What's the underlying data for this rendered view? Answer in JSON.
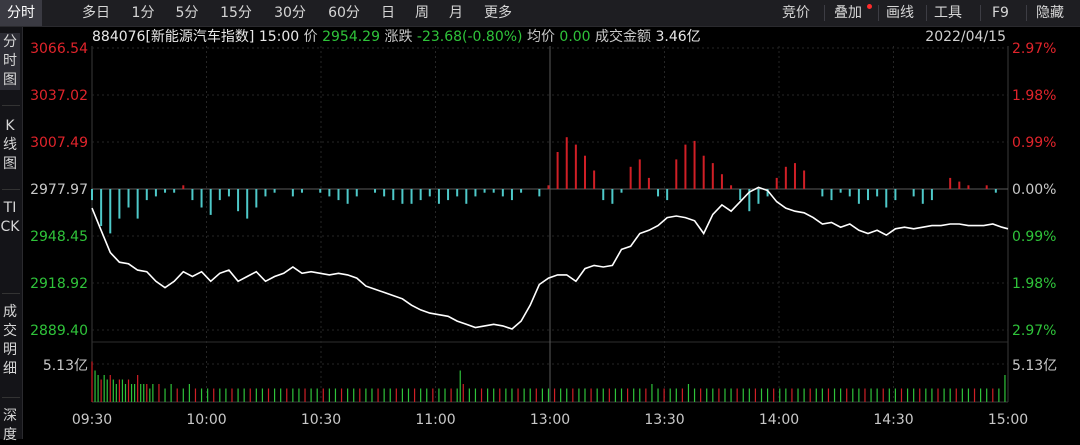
{
  "toolbar": {
    "tabs": [
      {
        "label": "分时",
        "active": true
      },
      {
        "label": "多日"
      },
      {
        "label": "1分"
      },
      {
        "label": "5分"
      },
      {
        "label": "15分"
      },
      {
        "label": "30分"
      },
      {
        "label": "60分"
      },
      {
        "label": "日"
      },
      {
        "label": "周"
      },
      {
        "label": "月"
      },
      {
        "label": "更多"
      }
    ],
    "tools": [
      {
        "label": "竞价"
      },
      {
        "label": "叠加"
      },
      {
        "label": "画线"
      },
      {
        "label": "工具"
      },
      {
        "label": "F9"
      },
      {
        "label": "隐藏"
      }
    ]
  },
  "sidebar": {
    "items": [
      {
        "label": "分时图",
        "active": true
      },
      {
        "label": "K线图"
      },
      {
        "label": "TICK"
      },
      {
        "label": "成交明细"
      },
      {
        "label": "深度"
      }
    ]
  },
  "info": {
    "code_name": "884076[新能源汽车指数]",
    "time": "15:00",
    "price_label": "价",
    "price": "2954.29",
    "change_label": "涨跌",
    "change": "-23.68(-0.80%)",
    "avg_label": "均价",
    "avg": "0.00",
    "amount_label": "成交金额",
    "amount": "3.46亿",
    "date": "2022/04/15"
  },
  "colors": {
    "up": "#e0242b",
    "down": "#2fc33a",
    "bar_up": "#d01f26",
    "bar_down": "#4ec9c9",
    "line": "#ffffff"
  },
  "chart_data": {
    "type": "line",
    "base_price": 2977.97,
    "ylim": [
      2889.4,
      3066.54
    ],
    "price_ticks": [
      "3066.54",
      "3037.02",
      "3007.49",
      "2977.97",
      "2948.45",
      "2918.92",
      "2889.40"
    ],
    "pct_ticks": [
      "2.97%",
      "1.98%",
      "0.99%",
      "0.00%",
      "0.99%",
      "1.98%",
      "2.97%"
    ],
    "volume_max_label": "5.13亿",
    "xlabels": [
      "09:30",
      "10:00",
      "10:30",
      "11:00",
      "13:00",
      "13:30",
      "14:00",
      "14:30",
      "15:00"
    ],
    "price_series": [
      [
        0,
        2966
      ],
      [
        3,
        2952
      ],
      [
        6,
        2938
      ],
      [
        9,
        2932
      ],
      [
        12,
        2931
      ],
      [
        15,
        2927
      ],
      [
        18,
        2926
      ],
      [
        21,
        2920
      ],
      [
        24,
        2916
      ],
      [
        27,
        2920
      ],
      [
        30,
        2926
      ],
      [
        33,
        2923
      ],
      [
        36,
        2926
      ],
      [
        39,
        2920
      ],
      [
        42,
        2925
      ],
      [
        45,
        2927
      ],
      [
        48,
        2920
      ],
      [
        51,
        2923
      ],
      [
        54,
        2926
      ],
      [
        57,
        2920
      ],
      [
        60,
        2923
      ],
      [
        63,
        2925
      ],
      [
        66,
        2929
      ],
      [
        69,
        2925
      ],
      [
        72,
        2926
      ],
      [
        75,
        2925
      ],
      [
        78,
        2924
      ],
      [
        81,
        2925
      ],
      [
        84,
        2924
      ],
      [
        87,
        2922
      ],
      [
        90,
        2917
      ],
      [
        93,
        2915
      ],
      [
        96,
        2913
      ],
      [
        99,
        2911
      ],
      [
        102,
        2909
      ],
      [
        105,
        2905
      ],
      [
        108,
        2902
      ],
      [
        111,
        2900
      ],
      [
        114,
        2899
      ],
      [
        117,
        2898
      ],
      [
        120,
        2895
      ],
      [
        123,
        2893
      ],
      [
        126,
        2891
      ],
      [
        129,
        2892
      ],
      [
        132,
        2893
      ],
      [
        135,
        2892
      ],
      [
        138,
        2890
      ],
      [
        141,
        2895
      ],
      [
        144,
        2905
      ],
      [
        147,
        2918
      ],
      [
        150,
        2922
      ],
      [
        153,
        2924
      ],
      [
        156,
        2924
      ],
      [
        159,
        2920
      ],
      [
        162,
        2928
      ],
      [
        165,
        2930
      ],
      [
        168,
        2929
      ],
      [
        171,
        2930
      ],
      [
        174,
        2940
      ],
      [
        177,
        2942
      ],
      [
        180,
        2950
      ],
      [
        183,
        2952
      ],
      [
        186,
        2955
      ],
      [
        189,
        2960
      ],
      [
        192,
        2961
      ],
      [
        195,
        2960
      ],
      [
        198,
        2958
      ],
      [
        201,
        2950
      ],
      [
        204,
        2962
      ],
      [
        207,
        2968
      ],
      [
        210,
        2964
      ],
      [
        213,
        2970
      ],
      [
        216,
        2976
      ],
      [
        219,
        2979
      ],
      [
        222,
        2977
      ],
      [
        225,
        2970
      ],
      [
        228,
        2966
      ],
      [
        231,
        2964
      ],
      [
        234,
        2963
      ],
      [
        237,
        2960
      ],
      [
        240,
        2956
      ],
      [
        243,
        2957
      ],
      [
        246,
        2954
      ],
      [
        249,
        2956
      ],
      [
        252,
        2952
      ],
      [
        255,
        2950
      ],
      [
        258,
        2952
      ],
      [
        261,
        2949
      ],
      [
        264,
        2953
      ],
      [
        267,
        2954
      ],
      [
        270,
        2953
      ],
      [
        273,
        2954
      ],
      [
        276,
        2955
      ],
      [
        279,
        2955
      ],
      [
        282,
        2956
      ],
      [
        285,
        2956
      ],
      [
        288,
        2955
      ],
      [
        291,
        2955
      ],
      [
        293,
        2955
      ],
      [
        296,
        2956
      ],
      [
        299,
        2954
      ],
      [
        301,
        2953
      ]
    ],
    "breadth_series": [
      [
        0,
        -3
      ],
      [
        3,
        -10
      ],
      [
        6,
        -12
      ],
      [
        9,
        -8
      ],
      [
        12,
        -5
      ],
      [
        15,
        -8
      ],
      [
        18,
        -3
      ],
      [
        21,
        -2
      ],
      [
        24,
        -1
      ],
      [
        27,
        -1
      ],
      [
        30,
        1
      ],
      [
        33,
        -3
      ],
      [
        36,
        -5
      ],
      [
        39,
        -7
      ],
      [
        42,
        -3
      ],
      [
        45,
        -2
      ],
      [
        48,
        -6
      ],
      [
        51,
        -8
      ],
      [
        54,
        -5
      ],
      [
        57,
        -2
      ],
      [
        60,
        -1
      ],
      [
        63,
        0
      ],
      [
        66,
        -2
      ],
      [
        69,
        -1
      ],
      [
        72,
        0
      ],
      [
        75,
        -1
      ],
      [
        78,
        -2
      ],
      [
        81,
        -3
      ],
      [
        84,
        -4
      ],
      [
        87,
        -2
      ],
      [
        90,
        0
      ],
      [
        93,
        -1
      ],
      [
        96,
        -2
      ],
      [
        99,
        -3
      ],
      [
        102,
        -4
      ],
      [
        105,
        -4
      ],
      [
        108,
        -3
      ],
      [
        111,
        -2
      ],
      [
        114,
        -4
      ],
      [
        117,
        -3
      ],
      [
        120,
        -2
      ],
      [
        123,
        -4
      ],
      [
        126,
        -2
      ],
      [
        129,
        -1
      ],
      [
        132,
        -1
      ],
      [
        135,
        -2
      ],
      [
        138,
        -3
      ],
      [
        141,
        -1
      ],
      [
        144,
        0
      ],
      [
        147,
        -2
      ],
      [
        150,
        1
      ],
      [
        153,
        10
      ],
      [
        156,
        14
      ],
      [
        159,
        12
      ],
      [
        162,
        9
      ],
      [
        165,
        5
      ],
      [
        168,
        -3
      ],
      [
        171,
        -4
      ],
      [
        174,
        -1
      ],
      [
        177,
        6
      ],
      [
        180,
        8
      ],
      [
        183,
        3
      ],
      [
        186,
        -2
      ],
      [
        189,
        -3
      ],
      [
        192,
        8
      ],
      [
        195,
        12
      ],
      [
        198,
        13
      ],
      [
        201,
        9
      ],
      [
        204,
        7
      ],
      [
        207,
        4
      ],
      [
        210,
        1
      ],
      [
        213,
        -3
      ],
      [
        216,
        -6
      ],
      [
        219,
        -4
      ],
      [
        222,
        -2
      ],
      [
        225,
        3
      ],
      [
        228,
        6
      ],
      [
        231,
        7
      ],
      [
        234,
        5
      ],
      [
        237,
        0
      ],
      [
        240,
        -2
      ],
      [
        243,
        -3
      ],
      [
        246,
        -1
      ],
      [
        249,
        -2
      ],
      [
        252,
        -4
      ],
      [
        255,
        -3
      ],
      [
        258,
        -2
      ],
      [
        261,
        -5
      ],
      [
        264,
        -3
      ],
      [
        267,
        0
      ],
      [
        270,
        -2
      ],
      [
        273,
        -4
      ],
      [
        276,
        -3
      ],
      [
        279,
        0
      ],
      [
        282,
        3
      ],
      [
        285,
        2
      ],
      [
        288,
        1
      ],
      [
        291,
        0
      ],
      [
        294,
        1
      ],
      [
        297,
        -1
      ],
      [
        300,
        0
      ]
    ],
    "volume_series": [
      [
        0,
        9
      ],
      [
        1,
        7
      ],
      [
        2,
        6
      ],
      [
        3,
        5
      ],
      [
        4,
        6
      ],
      [
        5,
        5
      ],
      [
        6,
        6
      ],
      [
        7,
        5
      ],
      [
        8,
        4
      ],
      [
        9,
        5
      ],
      [
        10,
        5
      ],
      [
        11,
        4
      ],
      [
        12,
        5
      ],
      [
        13,
        4
      ],
      [
        14,
        4
      ],
      [
        15,
        6
      ],
      [
        16,
        4
      ],
      [
        17,
        4
      ],
      [
        18,
        4
      ],
      [
        19,
        3
      ],
      [
        20,
        4
      ],
      [
        22,
        4
      ],
      [
        24,
        3
      ],
      [
        26,
        4
      ],
      [
        28,
        3
      ],
      [
        30,
        3
      ],
      [
        32,
        4
      ],
      [
        34,
        3
      ],
      [
        36,
        3
      ],
      [
        38,
        3
      ],
      [
        40,
        3
      ],
      [
        42,
        3
      ],
      [
        44,
        3
      ],
      [
        46,
        3
      ],
      [
        48,
        3
      ],
      [
        50,
        3
      ],
      [
        52,
        3
      ],
      [
        54,
        3
      ],
      [
        56,
        3
      ],
      [
        58,
        3
      ],
      [
        60,
        3
      ],
      [
        62,
        3
      ],
      [
        64,
        3
      ],
      [
        66,
        3
      ],
      [
        68,
        3
      ],
      [
        70,
        3
      ],
      [
        72,
        3
      ],
      [
        74,
        3
      ],
      [
        76,
        3
      ],
      [
        78,
        3
      ],
      [
        80,
        3
      ],
      [
        82,
        3
      ],
      [
        84,
        3
      ],
      [
        86,
        3
      ],
      [
        88,
        3
      ],
      [
        90,
        3
      ],
      [
        92,
        3
      ],
      [
        94,
        3
      ],
      [
        96,
        3
      ],
      [
        98,
        3
      ],
      [
        100,
        3
      ],
      [
        102,
        3
      ],
      [
        104,
        3
      ],
      [
        106,
        3
      ],
      [
        108,
        3
      ],
      [
        110,
        3
      ],
      [
        112,
        3
      ],
      [
        114,
        3
      ],
      [
        116,
        3
      ],
      [
        118,
        3
      ],
      [
        120,
        3
      ],
      [
        121,
        7
      ],
      [
        122,
        4
      ],
      [
        124,
        3
      ],
      [
        126,
        3
      ],
      [
        128,
        3
      ],
      [
        130,
        3
      ],
      [
        132,
        3
      ],
      [
        134,
        3
      ],
      [
        136,
        3
      ],
      [
        138,
        3
      ],
      [
        140,
        3
      ],
      [
        142,
        3
      ],
      [
        144,
        3
      ],
      [
        146,
        3
      ],
      [
        148,
        3
      ],
      [
        150,
        3
      ],
      [
        152,
        3
      ],
      [
        154,
        3
      ],
      [
        156,
        3
      ],
      [
        158,
        3
      ],
      [
        160,
        3
      ],
      [
        162,
        3
      ],
      [
        164,
        3
      ],
      [
        166,
        3
      ],
      [
        168,
        3
      ],
      [
        170,
        3
      ],
      [
        172,
        3
      ],
      [
        174,
        3
      ],
      [
        176,
        3
      ],
      [
        178,
        3
      ],
      [
        180,
        3
      ],
      [
        182,
        3
      ],
      [
        184,
        4
      ],
      [
        186,
        3
      ],
      [
        188,
        3
      ],
      [
        190,
        3
      ],
      [
        192,
        3
      ],
      [
        194,
        3
      ],
      [
        196,
        4
      ],
      [
        198,
        3
      ],
      [
        200,
        3
      ],
      [
        202,
        3
      ],
      [
        204,
        3
      ],
      [
        206,
        3
      ],
      [
        208,
        3
      ],
      [
        210,
        3
      ],
      [
        212,
        3
      ],
      [
        214,
        3
      ],
      [
        216,
        3
      ],
      [
        218,
        3
      ],
      [
        220,
        3
      ],
      [
        222,
        3
      ],
      [
        224,
        3
      ],
      [
        226,
        3
      ],
      [
        228,
        3
      ],
      [
        230,
        3
      ],
      [
        232,
        3
      ],
      [
        234,
        3
      ],
      [
        236,
        3
      ],
      [
        238,
        3
      ],
      [
        240,
        3
      ],
      [
        242,
        3
      ],
      [
        244,
        3
      ],
      [
        246,
        3
      ],
      [
        248,
        3
      ],
      [
        250,
        3
      ],
      [
        252,
        3
      ],
      [
        254,
        3
      ],
      [
        256,
        3
      ],
      [
        258,
        3
      ],
      [
        260,
        3
      ],
      [
        262,
        3
      ],
      [
        264,
        3
      ],
      [
        266,
        3
      ],
      [
        268,
        3
      ],
      [
        270,
        3
      ],
      [
        272,
        3
      ],
      [
        274,
        3
      ],
      [
        276,
        3
      ],
      [
        278,
        3
      ],
      [
        280,
        3
      ],
      [
        282,
        3
      ],
      [
        284,
        3
      ],
      [
        286,
        3
      ],
      [
        288,
        3
      ],
      [
        290,
        3
      ],
      [
        292,
        3
      ],
      [
        294,
        3
      ],
      [
        296,
        3
      ],
      [
        298,
        3
      ],
      [
        300,
        6
      ]
    ]
  }
}
